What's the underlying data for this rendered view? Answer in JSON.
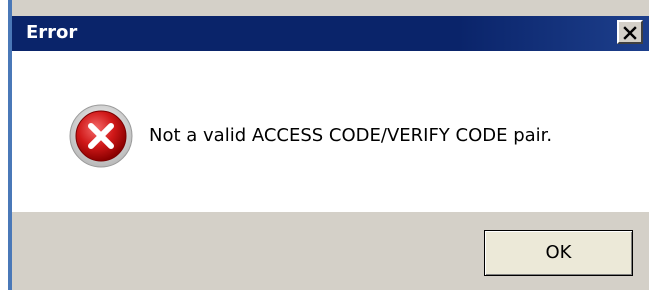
{
  "window": {
    "title": "Error",
    "close_icon": "close-icon",
    "colors": {
      "titlebar": "#0a246a",
      "frame": "#4a78b8",
      "face": "#d4d0c8",
      "content": "#ffffff",
      "error_icon": "#c8102e"
    }
  },
  "dialog": {
    "icon": "error-icon",
    "message": "Not a valid ACCESS CODE/VERIFY CODE pair."
  },
  "buttons": {
    "ok_label": "OK"
  }
}
